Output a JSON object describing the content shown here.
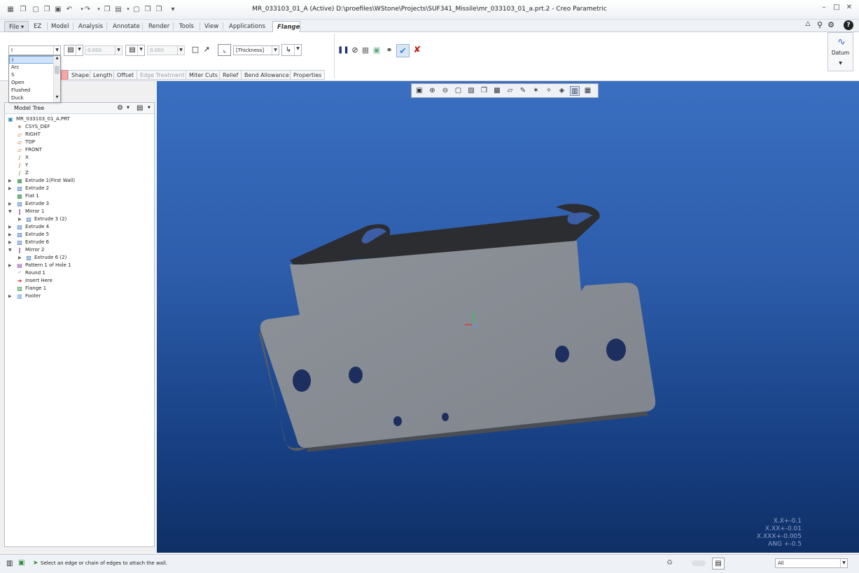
{
  "window": {
    "title": "MR_033103_01_A (Active) D:\\proefiles\\WStone\\Projects\\SUF341_Missile\\mr_033103_01_a.prt.2 - Creo Parametric",
    "minimize": "–",
    "restore": "□",
    "close": "✕"
  },
  "quick_access": [
    "▦",
    "❐",
    "▢",
    "❐",
    "▣",
    "↶",
    "▾",
    "↷",
    "▾",
    "❐",
    "▤",
    "▾",
    "▢",
    "❐",
    "❐",
    "▾"
  ],
  "tabs": [
    {
      "label": "File ▾"
    },
    {
      "label": "EZ"
    },
    {
      "label": "Model"
    },
    {
      "label": "Analysis"
    },
    {
      "label": "Annotate"
    },
    {
      "label": "Render"
    },
    {
      "label": "Tools"
    },
    {
      "label": "View"
    },
    {
      "label": "Applications"
    },
    {
      "label": "Flange"
    }
  ],
  "ribbon": {
    "shape_value": "I",
    "length_value_1": "0.000",
    "length_value_2": "0.000",
    "thickness_value": "[Thickness]",
    "datum_label": "Datum"
  },
  "wall_dropdown": {
    "options": [
      "I",
      "Arc",
      "S",
      "Open",
      "Flushed",
      "Duck"
    ],
    "selected": "I"
  },
  "subtabs": [
    "Shape",
    "Length",
    "Offset",
    "Edge Treatment",
    "Miter Cuts",
    "Relief",
    "Bend Allowance",
    "Properties"
  ],
  "model_tree": {
    "title": "Model Tree",
    "items": [
      {
        "label": "MR_033103_01_A.PRT",
        "icon": "part-icon"
      },
      {
        "label": "CSYS_DEF",
        "icon": "csys-icon"
      },
      {
        "label": "RIGHT",
        "icon": "datum-plane-icon"
      },
      {
        "label": "TOP",
        "icon": "datum-plane-icon"
      },
      {
        "label": "FRONT",
        "icon": "datum-plane-icon"
      },
      {
        "label": "X",
        "icon": "axis-icon"
      },
      {
        "label": "Y",
        "icon": "axis-icon"
      },
      {
        "label": "Z",
        "icon": "axis-icon"
      },
      {
        "label": "Extrude 1(First Wall)",
        "icon": "first-wall-icon"
      },
      {
        "label": "Extrude 2",
        "icon": "extrude-icon"
      },
      {
        "label": "Flat 1",
        "icon": "flat-wall-icon"
      },
      {
        "label": "Extrude 3",
        "icon": "extrude-icon"
      },
      {
        "label": "Mirror 1",
        "icon": "mirror-icon"
      },
      {
        "label": "Extrude 3 (2)",
        "icon": "extrude-icon"
      },
      {
        "label": "Extrude 4",
        "icon": "extrude-icon"
      },
      {
        "label": "Extrude 5",
        "icon": "extrude-icon"
      },
      {
        "label": "Extrude 6",
        "icon": "extrude-icon"
      },
      {
        "label": "Mirror 2",
        "icon": "mirror-icon"
      },
      {
        "label": "Extrude 6 (2)",
        "icon": "extrude-icon"
      },
      {
        "label": "Pattern 1 of Hole 1",
        "icon": "pattern-icon"
      },
      {
        "label": "Round 1",
        "icon": "round-icon"
      },
      {
        "label": "Insert Here",
        "icon": "insert-arrow-icon"
      },
      {
        "label": "Flange 1",
        "icon": "flange-icon"
      },
      {
        "label": "Footer",
        "icon": "footer-icon"
      }
    ]
  },
  "tolerance": [
    "X.X+-0.1",
    "X.XX+-0.01",
    "X.XXX+-0.005",
    "ANG +-0.5"
  ],
  "status": {
    "message": "Select an edge or chain of edges to attach the wall.",
    "filter": "All"
  },
  "colors": {
    "background_top": "#3a6fc1",
    "background_bottom": "#0f2f66",
    "part": "#8f9399",
    "accent_accept": "#3a8ad8",
    "accent_cancel": "#c81e1e"
  }
}
